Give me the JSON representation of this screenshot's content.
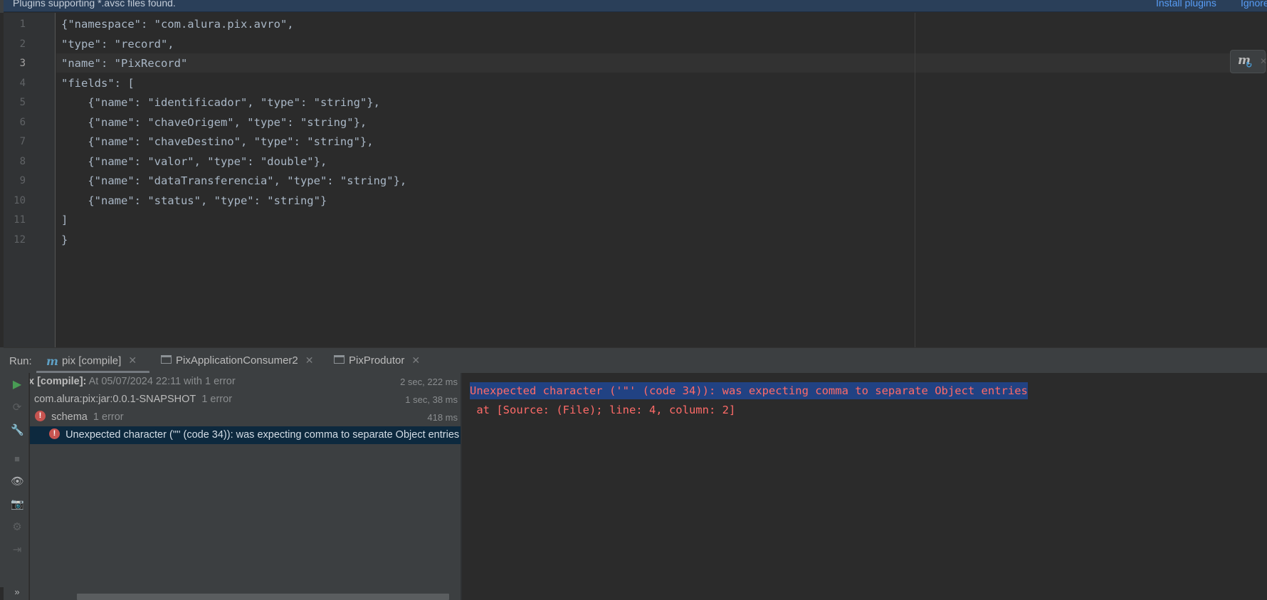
{
  "banner": {
    "message": "Plugins supporting *.avsc files found.",
    "install_label": "Install plugins",
    "ignore_label": "Ignore"
  },
  "editor": {
    "current_line": 3,
    "line_numbers": [
      "1",
      "2",
      "3",
      "4",
      "5",
      "6",
      "7",
      "8",
      "9",
      "10",
      "11",
      "12"
    ],
    "lines": [
      "{\"namespace\": \"com.alura.pix.avro\",",
      "\"type\": \"record\",",
      "\"name\": \"PixRecord\"",
      "\"fields\": [",
      "    {\"name\": \"identificador\", \"type\": \"string\"},",
      "    {\"name\": \"chaveOrigem\", \"type\": \"string\"},",
      "    {\"name\": \"chaveDestino\", \"type\": \"string\"},",
      "    {\"name\": \"valor\", \"type\": \"double\"},",
      "    {\"name\": \"dataTransferencia\", \"type\": \"string\"},",
      "    {\"name\": \"status\", \"type\": \"string\"}",
      "]",
      "}"
    ]
  },
  "run": {
    "label": "Run:",
    "tabs": [
      {
        "label": "pix [compile]",
        "icon": "maven-icon"
      },
      {
        "label": "PixApplicationConsumer2",
        "icon": "window-icon"
      },
      {
        "label": "PixProdutor",
        "icon": "window-icon"
      }
    ],
    "tree": [
      {
        "name": "x [compile]:",
        "detail": "At 05/07/2024 22:11 with 1 error",
        "duration": "2 sec, 222 ms"
      },
      {
        "name": "com.alura:pix:jar:0.0.1-SNAPSHOT",
        "detail": "1 error",
        "duration": "1 sec, 38 ms"
      },
      {
        "name": "schema",
        "detail": "1 error",
        "duration": "418 ms"
      },
      {
        "name": "Unexpected character ('\"' (code 34)): was expecting comma to separate Object entries",
        "detail": "",
        "duration": ""
      }
    ],
    "console": [
      "Unexpected character ('\"' (code 34)): was expecting comma to separate Object entries",
      " at [Source: (File); line: 4, column: 2]"
    ]
  },
  "colors": {
    "banner_bg": "#2a3f59",
    "link": "#589df6",
    "error_text": "#ff6b68",
    "selection": "#214283",
    "run_green": "#499c54",
    "error_badge": "#c75450"
  }
}
